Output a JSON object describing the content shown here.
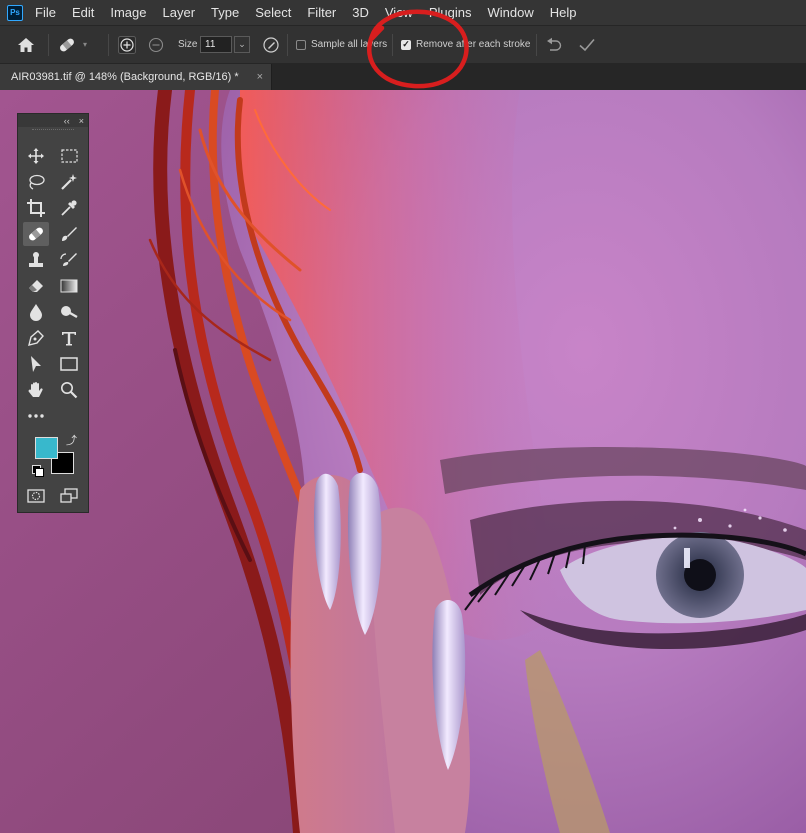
{
  "app": {
    "logo": "Ps"
  },
  "menu": [
    "File",
    "Edit",
    "Image",
    "Layer",
    "Type",
    "Select",
    "Filter",
    "3D",
    "View",
    "Plugins",
    "Window",
    "Help"
  ],
  "options": {
    "size_label": "Size",
    "size_value": "11",
    "sample_all_layers_label": "Sample all layers",
    "sample_all_layers_checked": false,
    "remove_after_label": "Remove after each stroke",
    "remove_after_checked": true
  },
  "document_tab": {
    "title": "AIR03981.tif @ 148% (Background, RGB/16) *",
    "close": "×"
  },
  "tools_panel": {
    "collapse": "‹‹",
    "close": "×",
    "foreground_color": "#38b8cc",
    "background_color": "#000000",
    "tools": [
      "move-tool",
      "marquee-tool",
      "lasso-tool",
      "magic-wand-tool",
      "crop-tool",
      "eyedropper-tool",
      "remove-tool",
      "brush-tool",
      "clone-stamp-tool",
      "history-brush-tool",
      "eraser-tool",
      "gradient-tool",
      "blur-tool",
      "dodge-tool",
      "pen-tool",
      "type-tool",
      "path-selection-tool",
      "rectangle-tool",
      "hand-tool",
      "zoom-tool",
      "edit-toolbar"
    ]
  },
  "annotation": {
    "color": "#d81e1e"
  }
}
